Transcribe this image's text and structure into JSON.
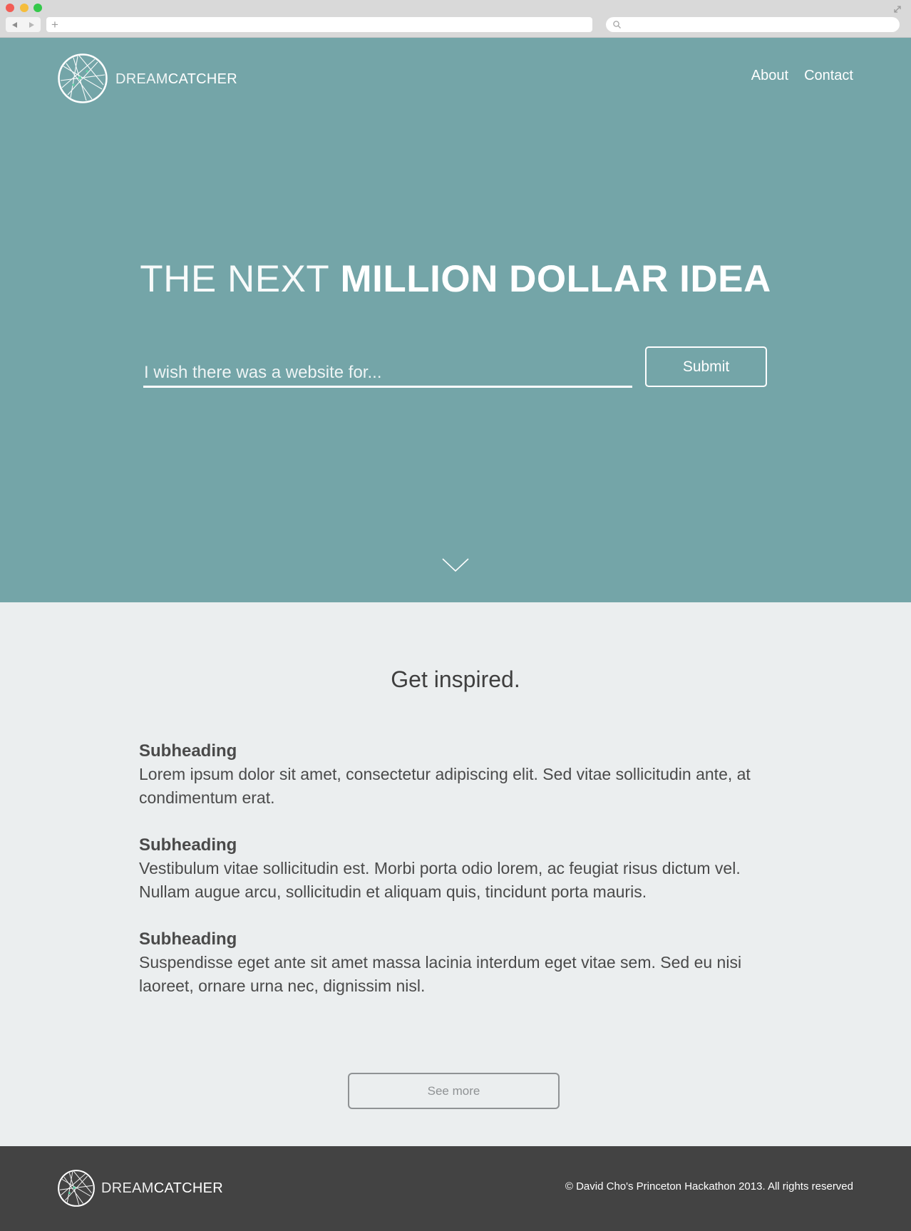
{
  "browser": {
    "new_tab_symbol": "+"
  },
  "header": {
    "brand": {
      "light": "DREAM",
      "bold": "CATCHER"
    },
    "nav": [
      {
        "label": "About"
      },
      {
        "label": "Contact"
      }
    ]
  },
  "hero": {
    "headline_light": "THE NEXT",
    "headline_bold": "MILLION DOLLAR IDEA",
    "input_placeholder": "I wish there was a website for...",
    "submit_label": "Submit"
  },
  "inspiration": {
    "title": "Get inspired.",
    "items": [
      {
        "subheading": "Subheading",
        "body": "Lorem ipsum dolor sit amet, consectetur adipiscing elit. Sed vitae sollicitudin ante, at condimentum erat."
      },
      {
        "subheading": "Subheading",
        "body": "Vestibulum vitae sollicitudin est. Morbi porta odio lorem, ac feugiat risus dictum vel. Nullam augue arcu, sollicitudin et aliquam quis, tincidunt porta mauris."
      },
      {
        "subheading": "Subheading",
        "body": "Suspendisse eget ante sit amet massa lacinia interdum eget vitae sem. Sed eu nisi laoreet, ornare urna nec, dignissim nisl."
      }
    ],
    "see_more_label": "See more"
  },
  "footer": {
    "brand": {
      "light": "DREAM",
      "bold": "CATCHER"
    },
    "copyright": "© David Cho's Princeton Hackathon 2013. All rights reserved"
  },
  "colors": {
    "hero_bg": "#74a5a8",
    "content_bg": "#ebeeef",
    "footer_bg": "#434343",
    "accent_dots": "#5fd3a8"
  },
  "icons": {
    "logo": "dreamcatcher-logo-icon",
    "scroll": "chevron-down-icon",
    "search": "search-icon"
  }
}
